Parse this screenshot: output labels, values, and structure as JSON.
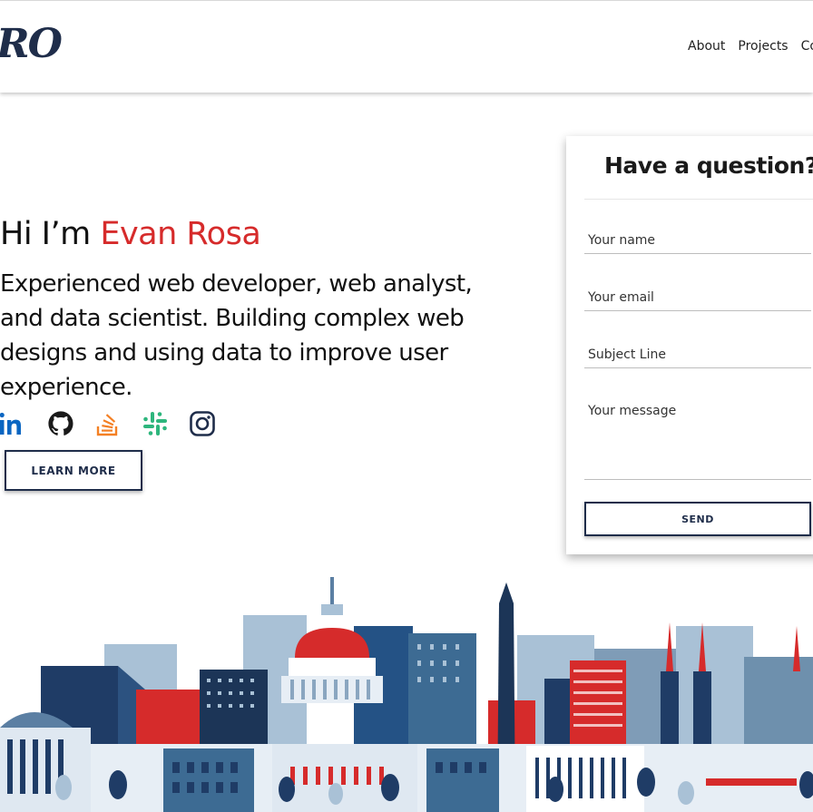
{
  "header": {
    "logo_text": "RO",
    "nav": [
      "About",
      "Projects",
      "Contact"
    ]
  },
  "hero": {
    "greeting": "Hi I’m ",
    "name": "Evan Rosa",
    "subtitle": "Experienced web developer, web analyst, and data scientist. Building complex web designs and using data to improve user experience.",
    "learn_more_label": "LEARN MORE"
  },
  "socials": [
    {
      "icon": "linkedin-icon",
      "color": "#0a66c2"
    },
    {
      "icon": "github-icon",
      "color": "#1a1a1a"
    },
    {
      "icon": "stackoverflow-icon",
      "color": "#f48024"
    },
    {
      "icon": "slack-icon",
      "color": "#2eb67d"
    },
    {
      "icon": "instagram-icon",
      "color": "#1f2d4a"
    }
  ],
  "contact": {
    "title": "Have a question?",
    "name_placeholder": "Your name",
    "email_placeholder": "Your email",
    "subject_placeholder": "Subject Line",
    "message_placeholder": "Your message",
    "send_label": "SEND"
  },
  "colors": {
    "accent": "#d62b2b",
    "navy": "#1f2d4a"
  }
}
